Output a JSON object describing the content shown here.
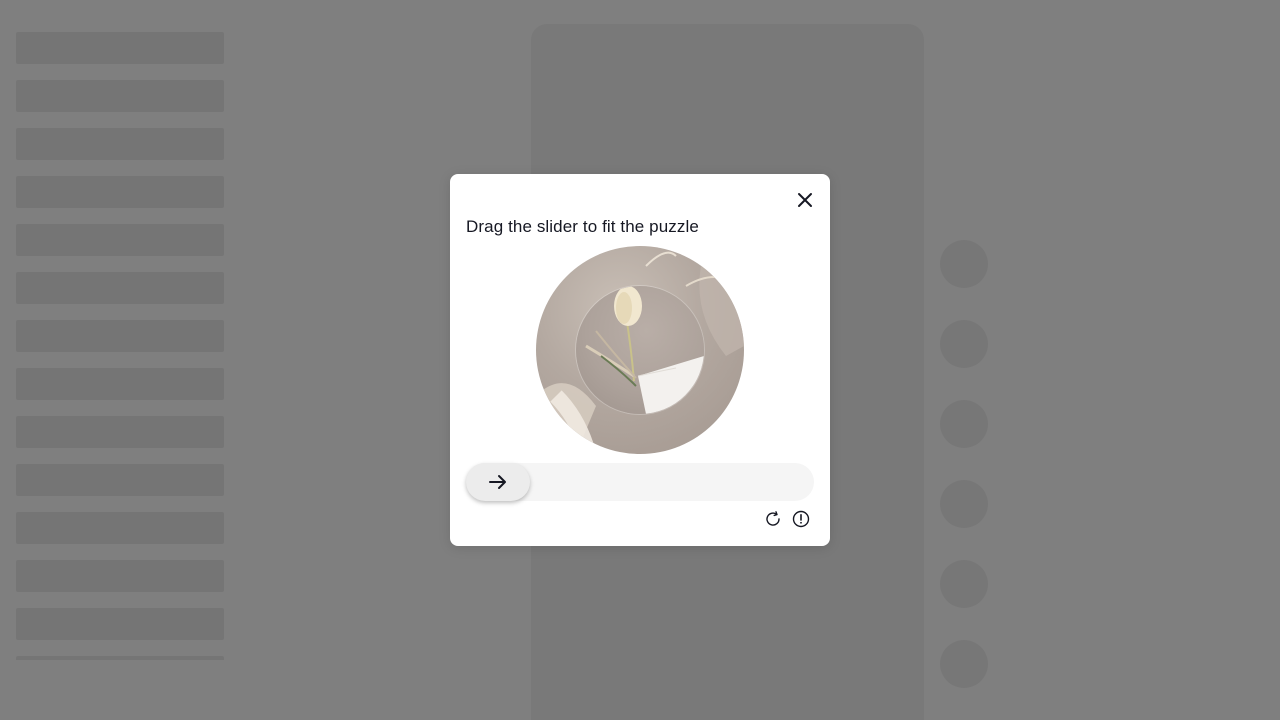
{
  "captcha": {
    "title": "Drag the slider to fit the puzzle",
    "close_icon": "close-icon",
    "slider_handle_icon": "arrow-right-icon",
    "refresh_icon": "refresh-icon",
    "report_icon": "alert-circle-icon",
    "slider_progress": 0
  },
  "background": {
    "skeleton_rows": 13,
    "action_buttons": 6
  },
  "colors": {
    "overlay": "#808080",
    "modal_bg": "#ffffff",
    "title": "#161823",
    "track": "#f5f5f5",
    "handle": "#ececec"
  }
}
